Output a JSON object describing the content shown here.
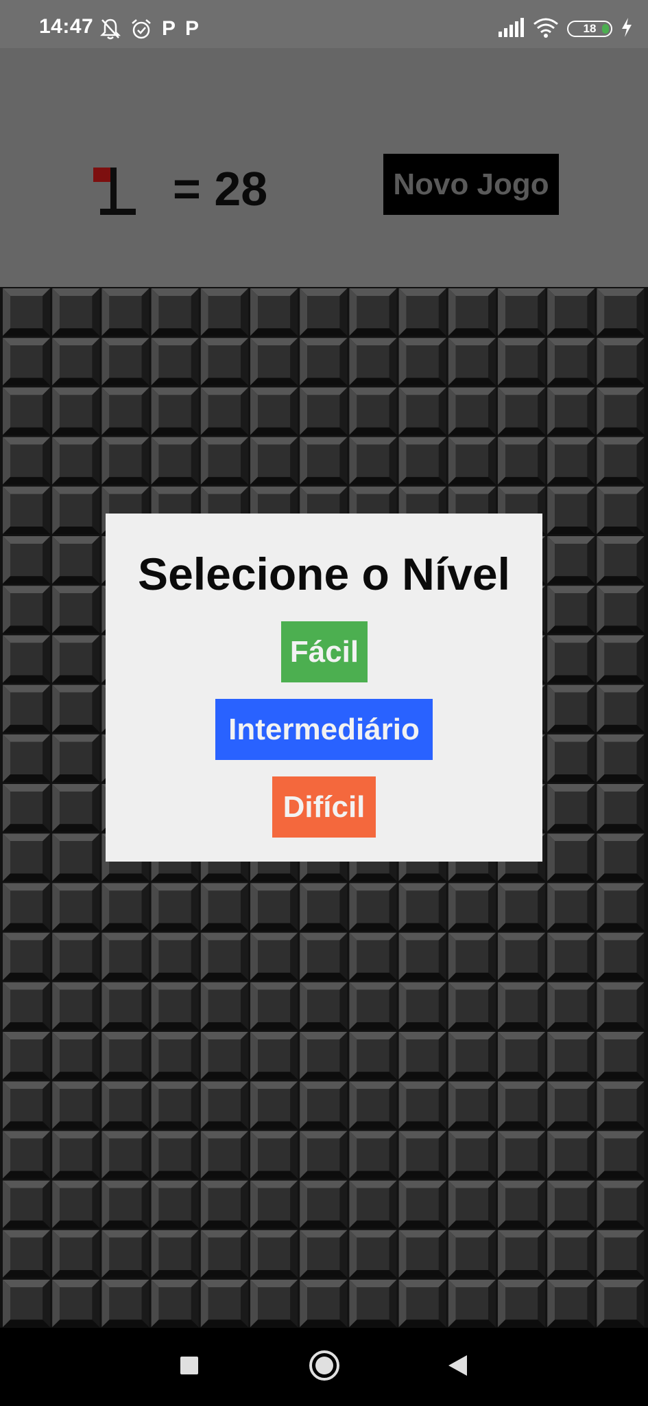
{
  "status_bar": {
    "time": "14:47",
    "left_icons": [
      "bell-off-icon",
      "alarm-icon",
      "p-app-icon",
      "p-app-icon"
    ],
    "p_label": "P",
    "right_icons": [
      "signal-icon",
      "wifi-icon",
      "battery-icon",
      "charging-icon"
    ],
    "battery_level": "18",
    "battery_fraction": 0.18,
    "battery_color": "#4caf50"
  },
  "header": {
    "flag_icon": "flag-icon",
    "mine_counter": "= 28",
    "new_game_label": "Novo Jogo"
  },
  "board": {
    "columns": 13,
    "rows": 21,
    "tile_color": "#2f2f2f",
    "highlight_color": "#575757",
    "shadow_color": "#0d0d0d"
  },
  "dialog": {
    "title": "Selecione o Nível",
    "buttons": [
      {
        "label": "Fácil",
        "color": "#4caf50"
      },
      {
        "label": "Intermediário",
        "color": "#2962ff"
      },
      {
        "label": "Difícil",
        "color": "#f4683d"
      }
    ]
  },
  "nav_bar": {
    "icons": [
      "recents-square-icon",
      "home-circle-icon",
      "back-triangle-icon"
    ]
  }
}
